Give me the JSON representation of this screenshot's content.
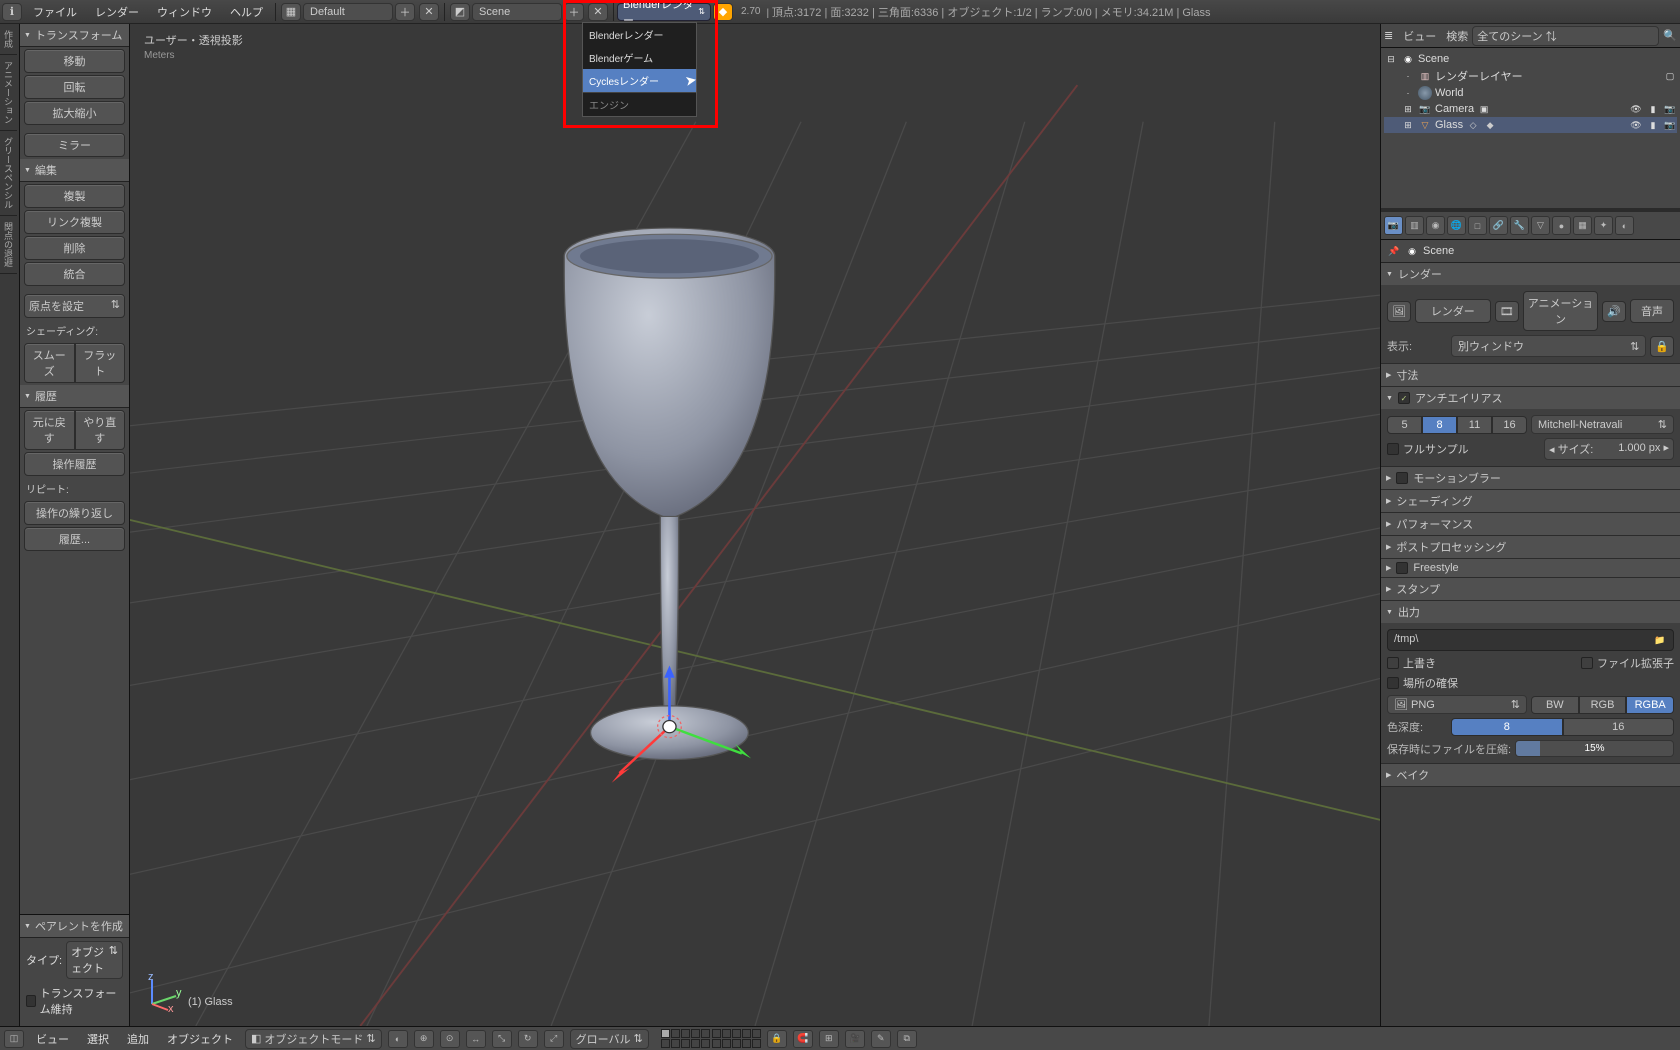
{
  "top": {
    "menus": [
      "ファイル",
      "レンダー",
      "ウィンドウ",
      "ヘルプ"
    ],
    "layout_label": "Default",
    "scene_label": "Scene",
    "engine_selected": "Blenderレンダー",
    "engine_options": [
      "Blenderレンダー",
      "Blenderゲーム",
      "Cyclesレンダー"
    ],
    "engine_category": "エンジン",
    "version": "2.70",
    "status": "頂点:3172 | 面:3232 | 三角面:6336 | オブジェクト:1/2 | ランプ:0/0 | メモリ:34.21M | Glass"
  },
  "left_tabs": [
    "作成",
    "アニメーション",
    "グリースペンシル",
    "関点の退避"
  ],
  "tools": {
    "transform_header": "トランスフォーム",
    "move": "移動",
    "rotate": "回転",
    "scale": "拡大縮小",
    "mirror": "ミラー",
    "edit_header": "編集",
    "duplicate": "複製",
    "duplicate_linked": "リンク複製",
    "delete": "削除",
    "join": "統合",
    "set_origin": "原点を設定",
    "shading_label": "シェーディング:",
    "smooth": "スムーズ",
    "flat": "フラット",
    "history_header": "履歴",
    "undo": "元に戻す",
    "redo": "やり直す",
    "undo_history": "操作履歴",
    "repeat_label": "リピート:",
    "repeat_last": "操作の繰り返し",
    "history": "履歴...",
    "parent_header": "ペアレントを作成",
    "type_label": "タイプ:",
    "type_value": "オブジェクト",
    "keep_transform": "トランスフォーム維持"
  },
  "viewport": {
    "title": "ユーザー・透視投影",
    "units": "Meters",
    "object_name": "(1) Glass"
  },
  "bottom": {
    "menus": [
      "ビュー",
      "選択",
      "追加",
      "オブジェクト"
    ],
    "mode": "オブジェクトモード",
    "orientation": "グローバル"
  },
  "outliner": {
    "header_label": "ビュー",
    "search_placeholder": "",
    "filter": "全てのシーン",
    "scene": "Scene",
    "render_layers": "レンダーレイヤー",
    "world": "World",
    "camera": "Camera",
    "object": "Glass"
  },
  "props": {
    "scene_bread": "Scene",
    "render_header": "レンダー",
    "render_btn": "レンダー",
    "anim_btn": "アニメーション",
    "audio_btn": "音声",
    "display_label": "表示:",
    "display_value": "別ウィンドウ",
    "dimensions_header": "寸法",
    "antialias_header": "アンチエイリアス",
    "aa_options": [
      "5",
      "8",
      "11",
      "16"
    ],
    "aa_selected": "8",
    "aa_filter": "Mitchell-Netravali",
    "full_sample": "フルサンプル",
    "size_label": "◂ サイズ:",
    "size_value": "1.000 px ▸",
    "motion_blur_header": "モーションブラー",
    "shading_header": "シェーディング",
    "performance_header": "パフォーマンス",
    "post_header": "ポストプロセッシング",
    "freestyle_header": "Freestyle",
    "stamp_header": "スタンプ",
    "output_header": "出力",
    "output_path": "/tmp\\",
    "overwrite": "上書き",
    "file_ext": "ファイル拡張子",
    "placeholders": "場所の確保",
    "format": "PNG",
    "color_modes": [
      "BW",
      "RGB",
      "RGBA"
    ],
    "color_selected": "RGBA",
    "depth_label": "色深度:",
    "depth_options": [
      "8",
      "16"
    ],
    "depth_selected": "8",
    "compression_label": "保存時にファイルを圧縮:",
    "compression_value": "15%",
    "bake_header": "ベイク"
  }
}
